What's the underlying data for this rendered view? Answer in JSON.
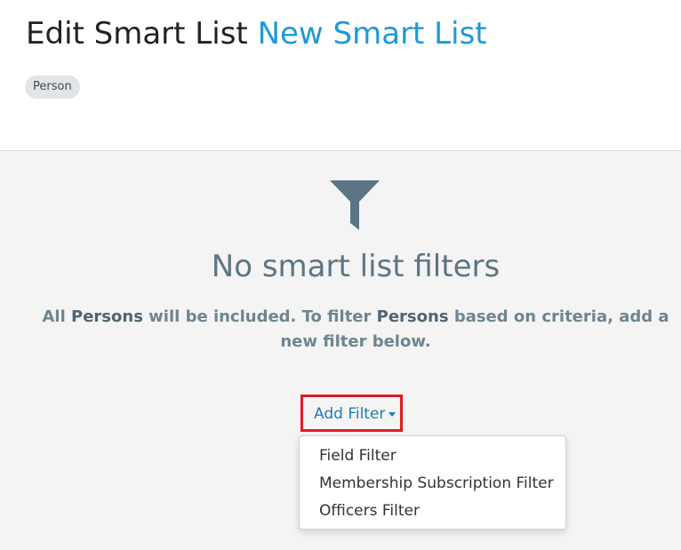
{
  "header": {
    "title_prefix": "Edit Smart List",
    "title_name": "New Smart List",
    "badge": "Person"
  },
  "empty_state": {
    "icon": "funnel-icon",
    "title": "No smart list filters",
    "desc_part1": "All ",
    "desc_bold1": "Persons",
    "desc_part2": " will be included. To filter ",
    "desc_bold2": "Persons",
    "desc_part3": " based on criteria, add a new filter below."
  },
  "add_filter": {
    "label": "Add Filter",
    "highlight_color": "#e21b23",
    "menu_items": [
      "Field Filter",
      "Membership Subscription Filter",
      "Officers Filter"
    ]
  },
  "colors": {
    "link": "#1d9ad6",
    "muted_heading": "#5c7584",
    "content_bg": "#f4f4f4"
  }
}
